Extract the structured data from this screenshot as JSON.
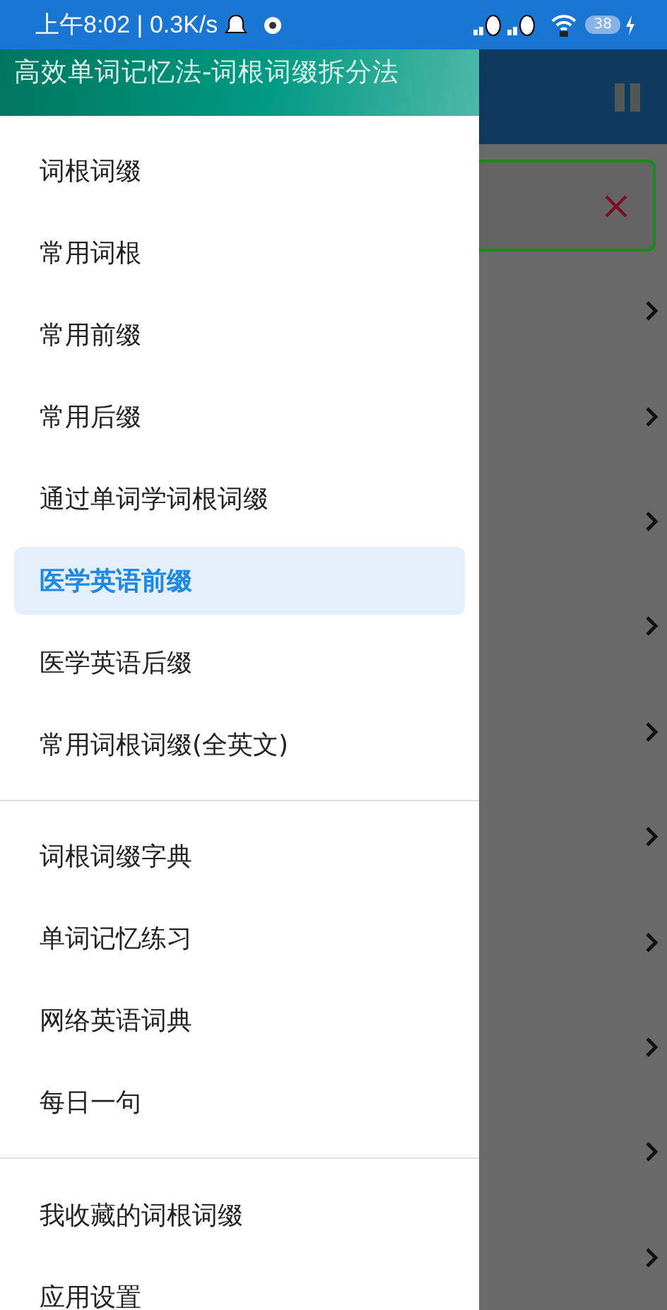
{
  "status_bar": {
    "time": "上午8:02 | 0.3K/s",
    "battery": "38"
  },
  "drawer": {
    "title": "高效单词记忆法-词根词缀拆分法",
    "groups": [
      {
        "items": [
          {
            "label": "词根词缀",
            "selected": false
          },
          {
            "label": "常用词根",
            "selected": false
          },
          {
            "label": "常用前缀",
            "selected": false
          },
          {
            "label": "常用后缀",
            "selected": false
          },
          {
            "label": "通过单词学词根词缀",
            "selected": false
          },
          {
            "label": "医学英语前缀",
            "selected": true
          },
          {
            "label": "医学英语后缀",
            "selected": false
          },
          {
            "label": "常用词根词缀(全英文)",
            "selected": false
          }
        ]
      },
      {
        "items": [
          {
            "label": "词根词缀字典",
            "selected": false
          },
          {
            "label": "单词记忆练习",
            "selected": false
          },
          {
            "label": "网络英语词典",
            "selected": false
          },
          {
            "label": "每日一句",
            "selected": false
          }
        ]
      },
      {
        "items": [
          {
            "label": "我收藏的词根词缀",
            "selected": false
          },
          {
            "label": "应用设置",
            "selected": false
          }
        ]
      }
    ]
  }
}
